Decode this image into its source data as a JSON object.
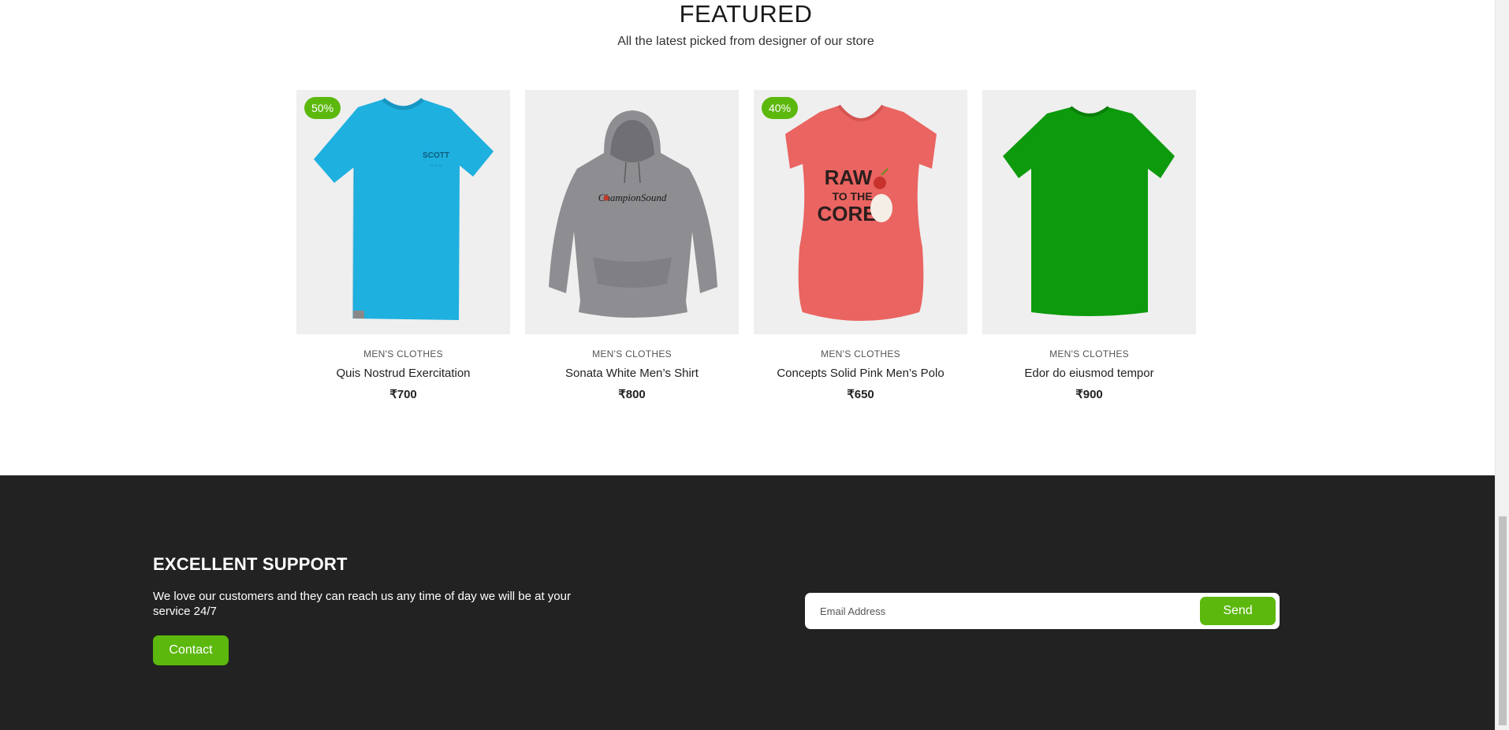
{
  "featured": {
    "title": "FEATURED",
    "subtitle": "All the latest picked from designer of our store"
  },
  "products": [
    {
      "badge": "50%",
      "category": "MEN'S CLOTHES",
      "name": "Quis Nostrud Exercitation",
      "price": "₹700",
      "image": "blue-tshirt",
      "color": "#1eb0df"
    },
    {
      "badge": "",
      "category": "MEN'S CLOTHES",
      "name": "Sonata White Men’s Shirt",
      "price": "₹800",
      "image": "grey-hoodie",
      "color": "#8e8e92",
      "print_text": "ChampionSound"
    },
    {
      "badge": "40%",
      "category": "MEN'S CLOTHES",
      "name": "Concepts Solid Pink Men’s Polo",
      "price": "₹650",
      "image": "pink-tshirt",
      "color": "#ea6461",
      "print_text": "RAW TO THE CORE"
    },
    {
      "badge": "",
      "category": "MEN'S CLOTHES",
      "name": "Edor do eiusmod tempor",
      "price": "₹900",
      "image": "green-tshirt",
      "color": "#0d9a0d"
    }
  ],
  "support": {
    "title": "EXCELLENT SUPPORT",
    "text": "We love our customers and they can reach us any time of day we will be at your service 24/7",
    "contact_label": "Contact",
    "email_placeholder": "Email Address",
    "send_label": "Send"
  },
  "colors": {
    "accent": "#5cb80d",
    "footer_bg": "#222222",
    "card_bg": "#efefef"
  }
}
